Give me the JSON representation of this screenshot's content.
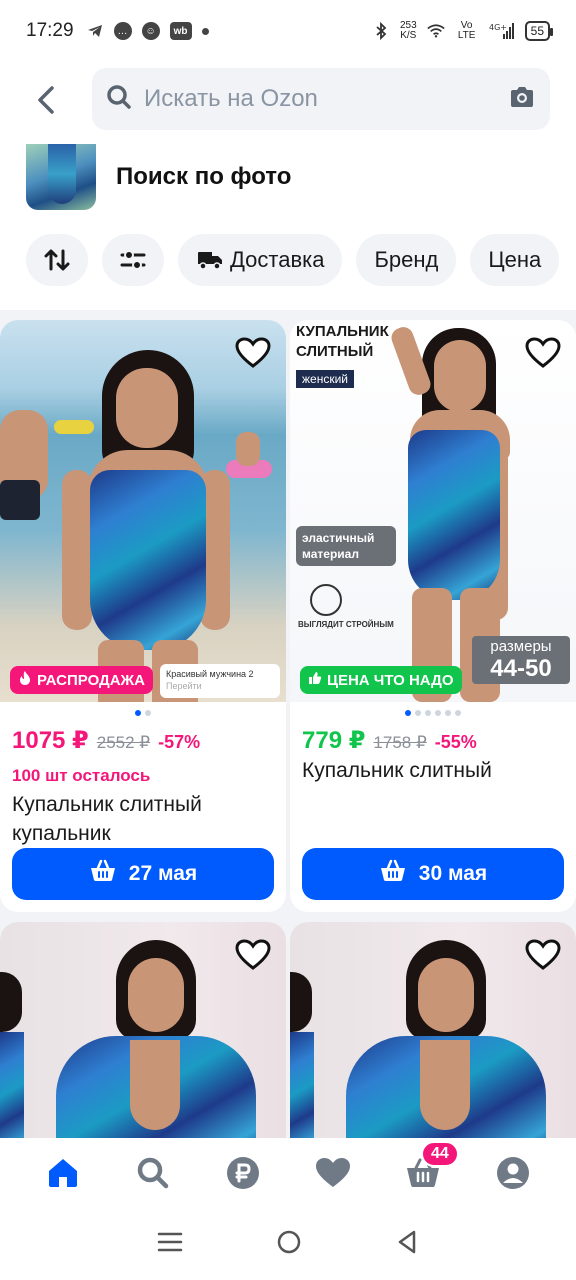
{
  "status_bar": {
    "time": "17:29",
    "net_speed_value": "253",
    "net_speed_unit": "K/S",
    "vo_lte": "Vo LTE",
    "signal": "4G+",
    "battery": "55"
  },
  "header": {
    "search_placeholder": "Искать на Ozon"
  },
  "photo_search": {
    "label": "Поиск по фото"
  },
  "filters": {
    "delivery": "Доставка",
    "brand": "Бренд",
    "price": "Цена"
  },
  "products": [
    {
      "badge": "РАСПРОДАЖА",
      "ad_title": "Красивый мужчина 2",
      "ad_sub": "Перейти",
      "price": "1075 ₽",
      "old_price": "2552 ₽",
      "discount": "-57%",
      "stock": "100 шт осталось",
      "title": "Купальник слитный купальник",
      "delivery": "27 мая"
    },
    {
      "promo_title_line1": "КУПАЛЬНИК",
      "promo_title_line2": "СЛИТНЫЙ",
      "promo_tag": "женский",
      "promo_elastic": "эластичный материал",
      "promo_small": "ВЫГЛЯДИТ СТРОЙНЫМ",
      "sizes_label": "размеры",
      "sizes_value": "44-50",
      "badge": "ЦЕНА ЧТО НАДО",
      "price": "779 ₽",
      "old_price": "1758 ₽",
      "discount": "-55%",
      "title": "Купальник слитный",
      "delivery": "30 мая"
    }
  ],
  "bottom_nav": {
    "cart_count": "44"
  },
  "colors": {
    "accent": "#005bff",
    "sale": "#f5167a",
    "green": "#10c44c"
  }
}
